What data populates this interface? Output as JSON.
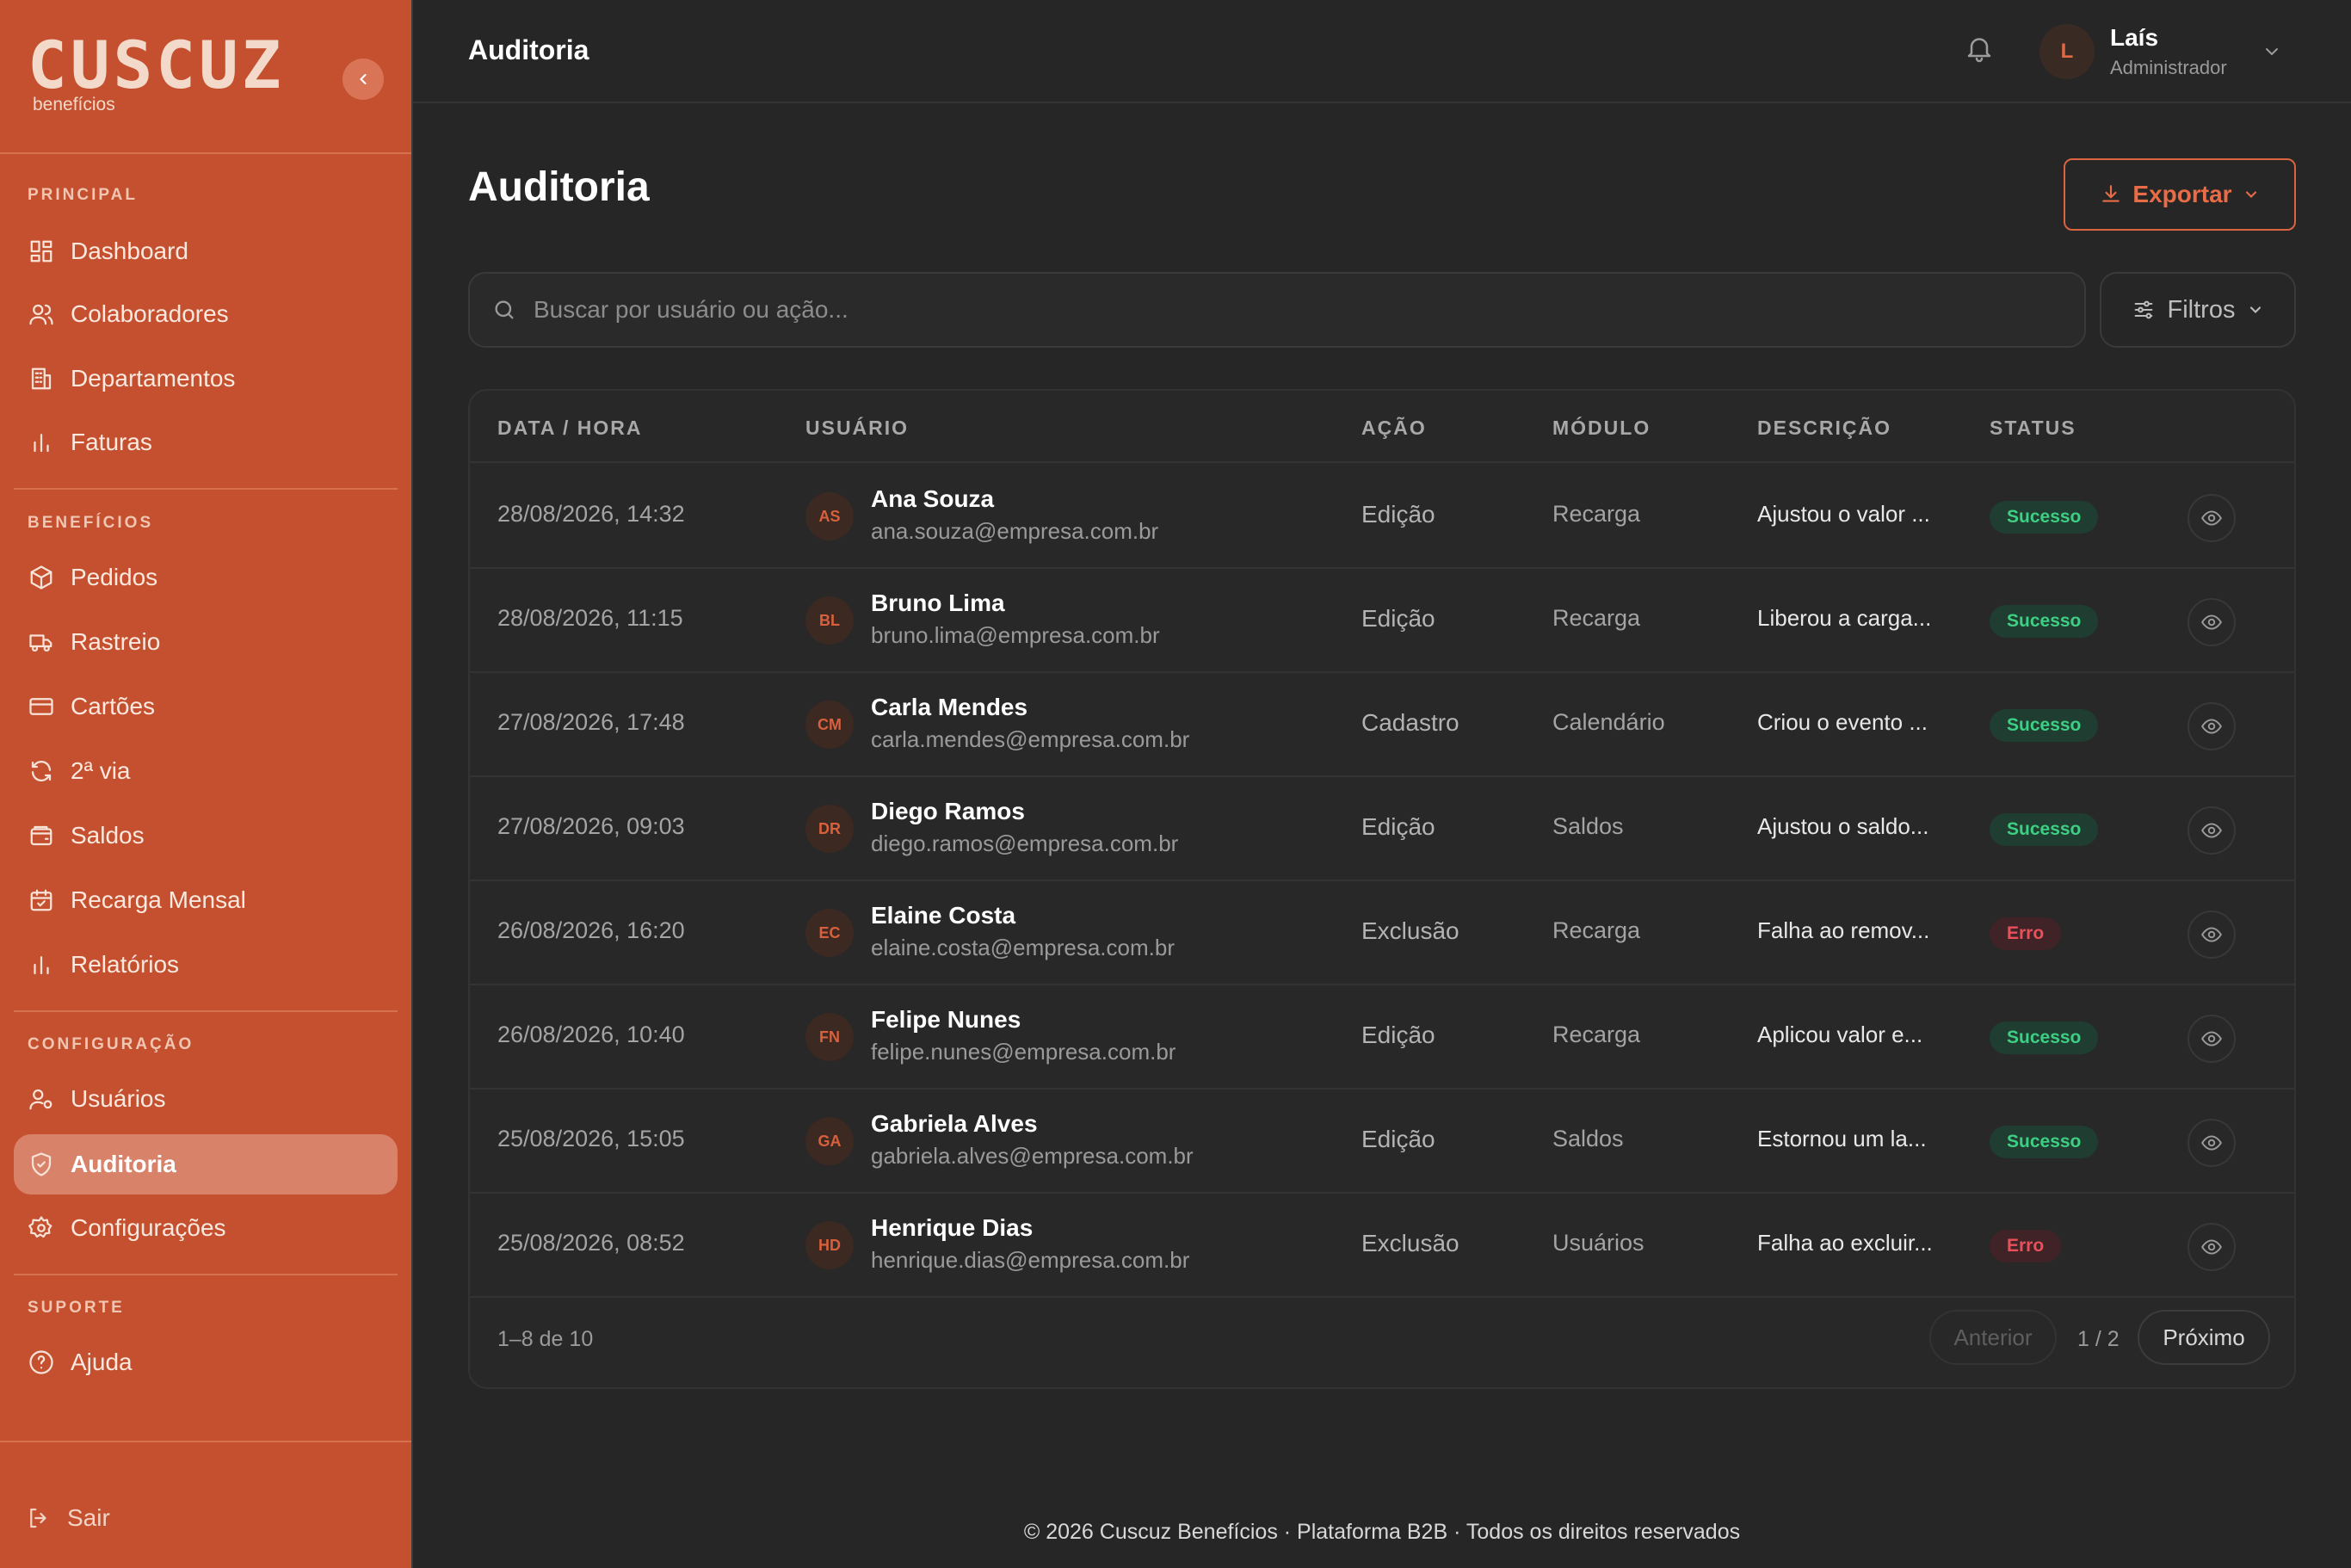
{
  "app": {
    "logo_text": "CUSCUZ",
    "logo_sub": "benefícios"
  },
  "sidebar": {
    "sections": {
      "principal": "PRINCIPAL",
      "beneficios": "BENEFÍCIOS",
      "configuracao": "CONFIGURAÇÃO",
      "suporte": "SUPORTE"
    },
    "items": [
      {
        "label": "Dashboard",
        "icon": "dashboard-icon"
      },
      {
        "label": "Colaboradores",
        "icon": "users-icon"
      },
      {
        "label": "Departamentos",
        "icon": "building-icon"
      },
      {
        "label": "Faturas",
        "icon": "bar-chart-icon"
      },
      {
        "label": "Pedidos",
        "icon": "package-icon"
      },
      {
        "label": "Rastreio",
        "icon": "truck-icon"
      },
      {
        "label": "Cartões",
        "icon": "credit-card-icon"
      },
      {
        "label": "2ª via",
        "icon": "refresh-icon"
      },
      {
        "label": "Saldos",
        "icon": "wallet-icon"
      },
      {
        "label": "Recarga Mensal",
        "icon": "calendar-check-icon"
      },
      {
        "label": "Relatórios",
        "icon": "bar-chart-icon"
      },
      {
        "label": "Usuários",
        "icon": "user-cog-icon"
      },
      {
        "label": "Auditoria",
        "icon": "shield-check-icon",
        "active": true
      },
      {
        "label": "Configurações",
        "icon": "gear-icon"
      },
      {
        "label": "Ajuda",
        "icon": "help-circle-icon"
      }
    ],
    "logout_label": "Sair"
  },
  "topbar": {
    "title": "Auditoria",
    "user": {
      "initial": "L",
      "name": "Laís",
      "role": "Administrador"
    }
  },
  "main": {
    "title": "Auditoria",
    "export_label": "Exportar",
    "search_placeholder": "Buscar por usuário ou ação...",
    "filters_label": "Filtros"
  },
  "table": {
    "columns": [
      "DATA / HORA",
      "USUÁRIO",
      "AÇÃO",
      "MÓDULO",
      "DESCRIÇÃO",
      "STATUS"
    ],
    "rows": [
      {
        "datetime": "28/08/2026, 14:32",
        "initials": "AS",
        "name": "Ana Souza",
        "email": "ana.souza@empresa.com.br",
        "action": "Edição",
        "module": "Recarga",
        "description": "Ajustou o valor ...",
        "status": "Sucesso"
      },
      {
        "datetime": "28/08/2026, 11:15",
        "initials": "BL",
        "name": "Bruno Lima",
        "email": "bruno.lima@empresa.com.br",
        "action": "Edição",
        "module": "Recarga",
        "description": "Liberou a carga...",
        "status": "Sucesso"
      },
      {
        "datetime": "27/08/2026, 17:48",
        "initials": "CM",
        "name": "Carla Mendes",
        "email": "carla.mendes@empresa.com.br",
        "action": "Cadastro",
        "module": "Calendário",
        "description": "Criou o evento ...",
        "status": "Sucesso"
      },
      {
        "datetime": "27/08/2026, 09:03",
        "initials": "DR",
        "name": "Diego Ramos",
        "email": "diego.ramos@empresa.com.br",
        "action": "Edição",
        "module": "Saldos",
        "description": "Ajustou o saldo...",
        "status": "Sucesso"
      },
      {
        "datetime": "26/08/2026, 16:20",
        "initials": "EC",
        "name": "Elaine Costa",
        "email": "elaine.costa@empresa.com.br",
        "action": "Exclusão",
        "module": "Recarga",
        "description": "Falha ao remov...",
        "status": "Erro"
      },
      {
        "datetime": "26/08/2026, 10:40",
        "initials": "FN",
        "name": "Felipe Nunes",
        "email": "felipe.nunes@empresa.com.br",
        "action": "Edição",
        "module": "Recarga",
        "description": "Aplicou valor e...",
        "status": "Sucesso"
      },
      {
        "datetime": "25/08/2026, 15:05",
        "initials": "GA",
        "name": "Gabriela Alves",
        "email": "gabriela.alves@empresa.com.br",
        "action": "Edição",
        "module": "Saldos",
        "description": "Estornou um la...",
        "status": "Sucesso"
      },
      {
        "datetime": "25/08/2026, 08:52",
        "initials": "HD",
        "name": "Henrique Dias",
        "email": "henrique.dias@empresa.com.br",
        "action": "Exclusão",
        "module": "Usuários",
        "description": "Falha ao excluir...",
        "status": "Erro"
      }
    ],
    "count_text": "1–8 de 10",
    "prev_label": "Anterior",
    "page_info": "1 / 2",
    "next_label": "Próximo"
  },
  "footer": {
    "text": "© 2026 Cuscuz Benefícios · Plataforma B2B · Todos os direitos reservados"
  },
  "colors": {
    "sidebar_bg": "#c4502f",
    "accent": "#e86c46",
    "success": "#3fcf84",
    "error": "#e9505a",
    "background": "#262626"
  }
}
